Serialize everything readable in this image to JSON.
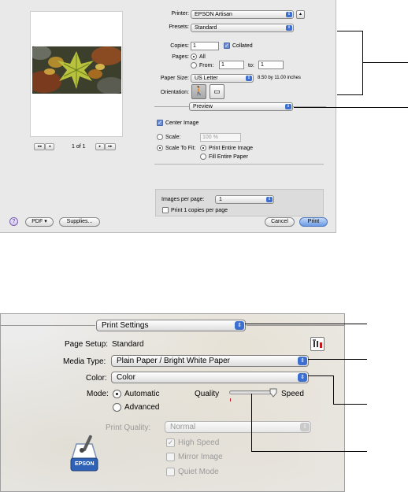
{
  "top_dialog": {
    "printer": {
      "label": "Printer:",
      "value": "EPSON Artisan"
    },
    "presets": {
      "label": "Presets:",
      "value": "Standard"
    },
    "copies": {
      "label": "Copies:",
      "value": "1",
      "collated_label": "Collated",
      "collated_checked": true
    },
    "pages": {
      "label": "Pages:",
      "all_label": "All",
      "from_label": "From:",
      "from_value": "1",
      "to_label": "to:",
      "to_value": "1"
    },
    "paper_size": {
      "label": "Paper Size:",
      "value": "US Letter",
      "dimensions": "8.50 by 11.00 inches"
    },
    "orientation": {
      "label": "Orientation:"
    },
    "panel": {
      "value": "Preview"
    },
    "center_image": {
      "label": "Center Image",
      "checked": true
    },
    "scale": {
      "label": "Scale:",
      "value": "100 %"
    },
    "scale_to_fit": {
      "label": "Scale To Fit:",
      "print_entire": "Print Entire Image",
      "fill_entire": "Fill Entire Paper"
    },
    "images_per_page": {
      "label": "Images per page:",
      "value": "1"
    },
    "print_copies_label": "Print 1 copies per page",
    "pager": {
      "first": "◂◂",
      "prev": "◂",
      "page_text": "1 of 1",
      "next": "▸",
      "last": "▸▸"
    },
    "footer": {
      "help": "?",
      "pdf": "PDF ▾",
      "supplies": "Supplies...",
      "cancel": "Cancel",
      "print": "Print"
    }
  },
  "bottom_dialog": {
    "panel": {
      "value": "Print Settings"
    },
    "page_setup": {
      "label": "Page Setup:",
      "value": "Standard"
    },
    "media_type": {
      "label": "Media Type:",
      "value": "Plain Paper / Bright White Paper"
    },
    "color": {
      "label": "Color:",
      "value": "Color"
    },
    "mode": {
      "label": "Mode:",
      "automatic": "Automatic",
      "advanced": "Advanced",
      "selected": "automatic"
    },
    "quality_slider": {
      "quality_label": "Quality",
      "speed_label": "Speed",
      "level": 1.0
    },
    "print_quality": {
      "label": "Print Quality:",
      "value": "Normal"
    },
    "high_speed": {
      "label": "High Speed",
      "checked": true
    },
    "mirror_image": {
      "label": "Mirror Image",
      "checked": false
    },
    "quiet_mode": {
      "label": "Quiet Mode",
      "checked": false
    },
    "logo_text": "EPSON"
  },
  "colors": {
    "accent": "#3d6fd1",
    "dialog_bg": "#e9e9e9",
    "disabled_text": "#9a9a9a"
  }
}
